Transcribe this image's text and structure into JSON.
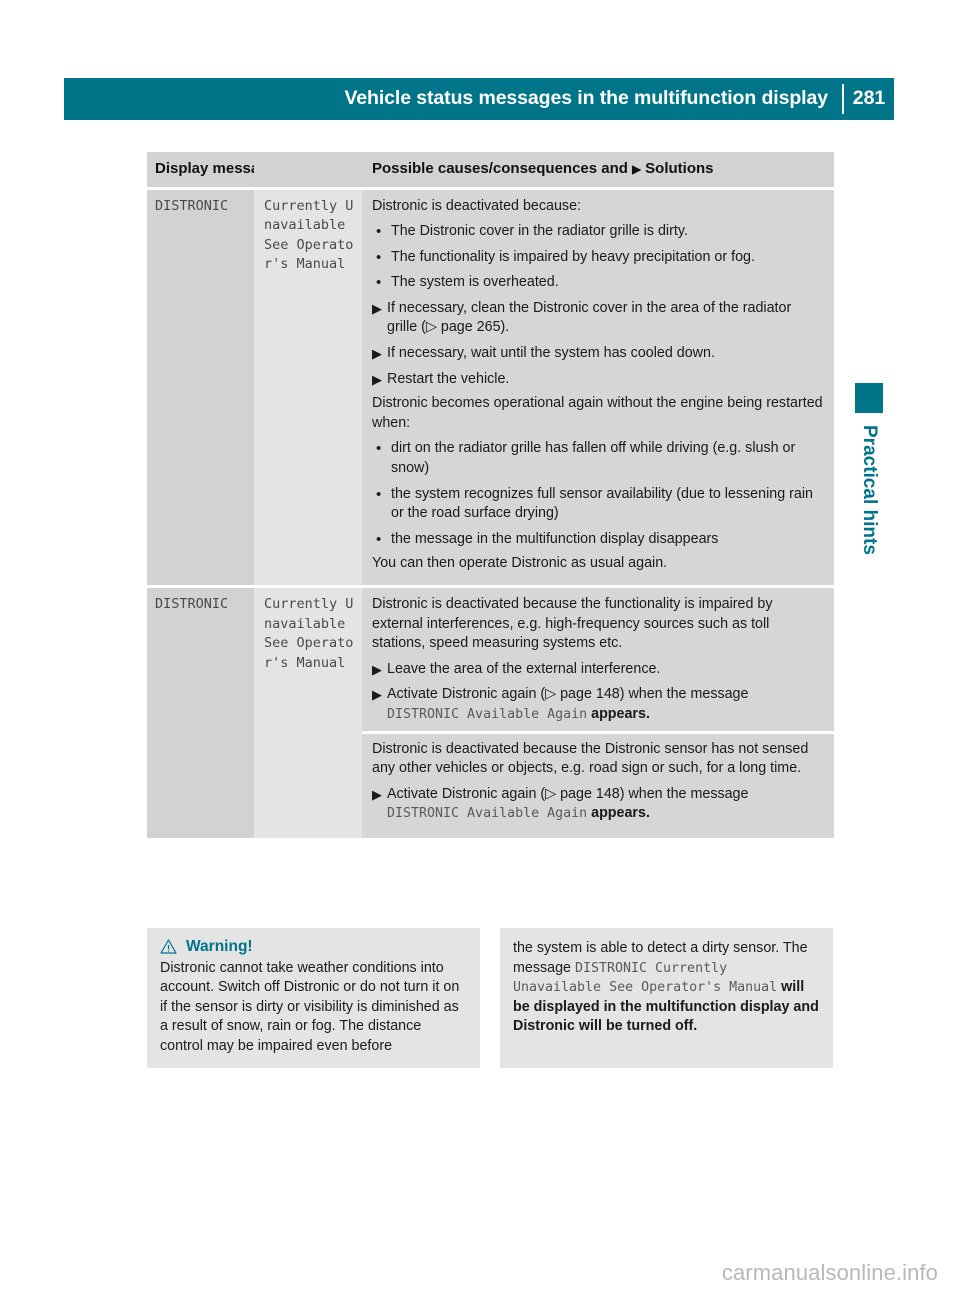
{
  "header": {
    "title": "Vehicle status messages in the multifunction display",
    "page_number": "281",
    "accent_color": "#00758a"
  },
  "side_tab": {
    "label": "Practical hints"
  },
  "table": {
    "columns": {
      "display_messages": "Display messages",
      "causes_prefix": "Possible causes/consequences and",
      "causes_suffix": "Solutions",
      "solutions_marker": "▶"
    },
    "rows": [
      {
        "message_name": "DISTRONIC",
        "message_detail": "Currently Unavailable See Operator's Manual",
        "blocks": [
          {
            "intro": "Distronic is deactivated because:",
            "items": [
              {
                "marker": "bullet",
                "text": "The Distronic cover in the radiator grille is dirty."
              },
              {
                "marker": "bullet",
                "text": "The functionality is impaired by heavy precipitation or fog."
              },
              {
                "marker": "bullet",
                "text": "The system is overheated."
              },
              {
                "marker": "arrow",
                "text": "If necessary, clean the Distronic cover in the area of the radiator grille (▷ page 265)."
              },
              {
                "marker": "arrow",
                "text": "If necessary, wait until the system has cooled down."
              },
              {
                "marker": "arrow",
                "text": "Restart the vehicle."
              }
            ],
            "mid": "Distronic becomes operational again without the engine being restarted when:",
            "items2": [
              {
                "marker": "bullet",
                "text": "dirt on the radiator grille has fallen off while driving (e.g. slush or snow)"
              },
              {
                "marker": "bullet",
                "text": "the system recognizes full sensor availability (due to lessening rain or the road surface drying)"
              },
              {
                "marker": "bullet",
                "text": "the message in the multifunction display disappears"
              }
            ],
            "outro": "You can then operate Distronic as usual again."
          }
        ]
      },
      {
        "message_name": "DISTRONIC",
        "message_detail": "Currently Unavailable See Operator's Manual",
        "blocks": [
          {
            "intro": "Distronic is deactivated because the functionality is impaired by external interferences, e.g. high-frequency sources such as toll stations, speed measuring systems etc.",
            "items": [
              {
                "marker": "arrow",
                "text": "Leave the area of the external interference."
              },
              {
                "marker": "arrow",
                "text_pre": "Activate Distronic again (▷ page 148) when the message ",
                "text_mono": "DISTRONIC Available Again",
                "text_post": " appears."
              }
            ]
          },
          {
            "intro": "Distronic is deactivated because the Distronic sensor has not sensed any other vehicles or objects, e.g. road sign or such, for a long time.",
            "items": [
              {
                "marker": "arrow",
                "text_pre": "Activate Distronic again (▷ page 148) when the message ",
                "text_mono": "DISTRONIC Available Again",
                "text_post": " appears."
              }
            ]
          }
        ]
      }
    ]
  },
  "warning": {
    "icon": "warning-triangle",
    "title": "Warning!",
    "left_text": "Distronic cannot take weather conditions into account. Switch off Distronic or do not turn it on if the sensor is dirty or visibility is diminished as a result of snow, rain or fog. The distance control may be impaired even before",
    "right_text_pre": "the system is able to detect a dirty sensor. The message ",
    "right_text_mono": "DISTRONIC Currently Unavailable See Operator's Manual",
    "right_text_post": " will be displayed in the multifunction display and Distronic will be turned off."
  },
  "watermark": {
    "text": "carmanualsonline.info"
  }
}
